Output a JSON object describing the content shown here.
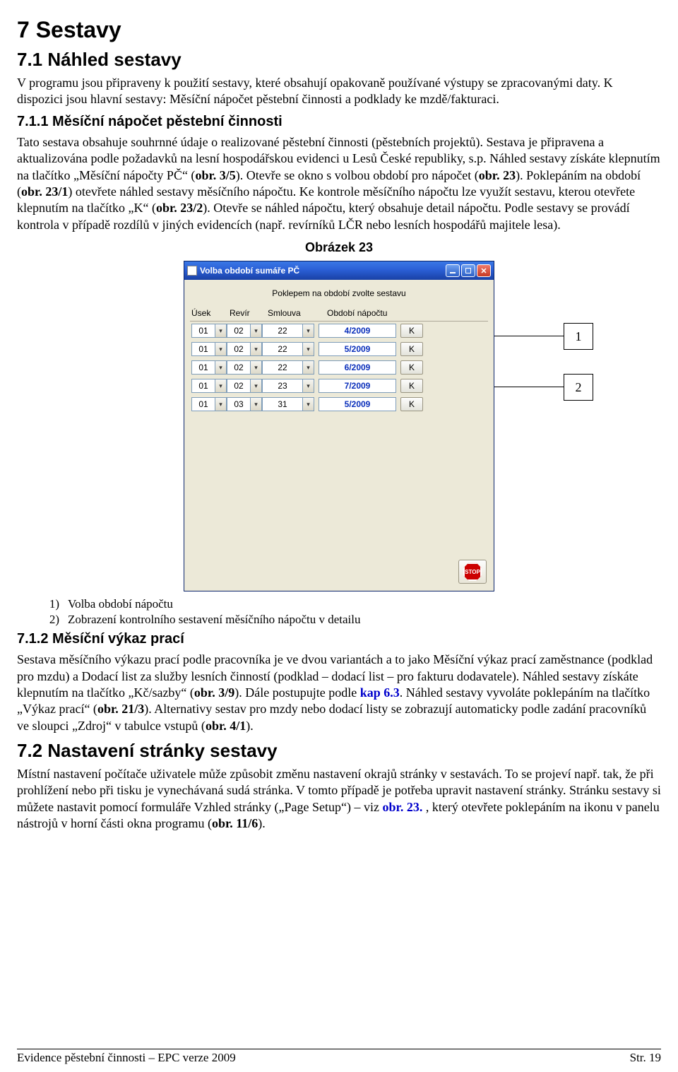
{
  "headings": {
    "h1": "7  Sestavy",
    "h2_1": "7.1  Náhled sestavy",
    "h3_1": "7.1.1  Měsíční nápočet pěstební činnosti",
    "h3_2": "7.1.2  Měsíční výkaz prací",
    "h2_2": "7.2  Nastavení stránky sestavy"
  },
  "paras": {
    "p1": "V programu jsou připraveny k použití sestavy, které obsahují opakovaně používané výstupy se zpracovanými daty. K dispozici jsou hlavní sestavy: Měsíční nápočet pěstební činnosti a podklady ke mzdě/fakturaci.",
    "p2a": "Tato sestava obsahuje souhrnné údaje o realizované pěstební činnosti (pěstebních projektů). Sestava je připravena a aktualizována podle požadavků na lesní hospodářskou evidenci u Lesů České republiky, s.p. Náhled sestavy získáte klepnutím na tlačítko „Měsíční nápočty PČ“ (",
    "p2b": "). Otevře se okno s volbou období pro nápočet (",
    "p2c": "). Poklepáním na období (",
    "p2d": ") otevřete náhled sestavy měsíčního nápočtu. Ke kontrole měsíčního nápočtu lze využít sestavu, kterou otevřete klepnutím na tlačítko „K“ (",
    "p2e": "). Otevře se náhled nápočtu, který obsahuje detail nápočtu. Podle sestavy se provádí kontrola v případě rozdílů v jiných evidencích (např. revírníků LČR nebo lesních hospodářů majitele lesa).",
    "p3a": "Sestava měsíčního výkazu prací podle pracovníka je ve dvou variantách a to jako Měsíční výkaz prací zaměstnance (podklad pro mzdu) a Dodací list za služby lesních činností (podklad – dodací list – pro fakturu dodavatele). Náhled sestavy získáte klepnutím na tlačítko „Kč/sazby“ (",
    "p3b": "). Dále postupujte podle ",
    "p3c": ". Náhled sestavy vyvoláte poklepáním na tlačítko „Výkaz prací“ (",
    "p3d": "). Alternativy sestav pro mzdy nebo dodací listy se zobrazují automaticky podle zadání pracovníků ve sloupci „Zdroj“ v tabulce vstupů (",
    "p3e": ").",
    "p4a": "Místní nastavení počítače uživatele může způsobit změnu nastavení okrajů stránky v sestavách. To se projeví např. tak, že při prohlížení nebo při tisku je vynechávaná sudá stránka. V tomto případě je potřeba upravit nastavení stránky. Stránku sestavy si můžete nastavit pomocí formuláře Vzhled stránky („Page Setup“) – viz ",
    "p4b": " , který otevřete poklepáním na ikonu v  panelu nástrojů v horní části okna programu (",
    "p4c": ")."
  },
  "refs": {
    "obr35": "obr. 3/5",
    "obr23": "obr. 23",
    "obr231": "obr. 23/1",
    "obr232": "obr. 23/2",
    "obr39": "obr. 3/9",
    "kap63": "kap 6.3",
    "obr213": "obr. 21/3",
    "obr41": "obr. 4/1",
    "obr23b": "obr. 23.",
    "obr116": "obr. 11/6"
  },
  "figure": {
    "caption": "Obrázek 23",
    "window_title": "Volba období sumáře PČ",
    "prompt": "Poklepem na období zvolte sestavu",
    "headers": {
      "usek": "Úsek",
      "revir": "Revír",
      "sml": "Smlouva",
      "obd": "Období nápočtu"
    },
    "rows": [
      {
        "usek": "01",
        "revir": "02",
        "sml": "22",
        "obd": "4/2009",
        "k": "K"
      },
      {
        "usek": "01",
        "revir": "02",
        "sml": "22",
        "obd": "5/2009",
        "k": "K"
      },
      {
        "usek": "01",
        "revir": "02",
        "sml": "22",
        "obd": "6/2009",
        "k": "K"
      },
      {
        "usek": "01",
        "revir": "02",
        "sml": "23",
        "obd": "7/2009",
        "k": "K"
      },
      {
        "usek": "01",
        "revir": "03",
        "sml": "31",
        "obd": "5/2009",
        "k": "K"
      }
    ],
    "stop": "STOP",
    "callouts": {
      "c1": "1",
      "c2": "2"
    }
  },
  "legend": {
    "n1": "1)",
    "t1": "Volba období nápočtu",
    "n2": "2)",
    "t2": "Zobrazení kontrolního sestavení měsíčního nápočtu v detailu"
  },
  "footer": {
    "left": "Evidence pěstební činnosti – EPC verze 2009",
    "right": "Str. 19"
  }
}
